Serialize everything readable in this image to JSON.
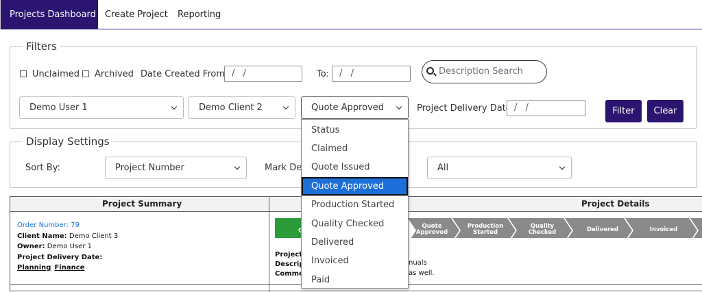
{
  "nav": {
    "tabs": [
      {
        "label": "Projects Dashboard",
        "active": true
      },
      {
        "label": "Create Project",
        "active": false
      },
      {
        "label": "Reporting",
        "active": false
      }
    ]
  },
  "filters": {
    "legend": "Filters",
    "unclaimed_label": "Unclaimed",
    "archived_label": "Archived",
    "date_created_from_label": "Date Created From:",
    "date_from_value": "/ /",
    "to_label": "To:",
    "date_to_value": "/ /",
    "search_placeholder": "Description Search",
    "user_select": "Demo User 1",
    "client_select": "Demo Client 2",
    "status_select": "Quote Approved",
    "delivery_date_label": "Project Delivery Date",
    "delivery_date_value": "/ /",
    "filter_button": "Filter",
    "clear_button": "Clear"
  },
  "status_dropdown": {
    "options": [
      "Status",
      "Claimed",
      "Quote Issued",
      "Quote Approved",
      "Production Started",
      "Quality Checked",
      "Delivered",
      "Invoiced",
      "Paid"
    ],
    "selected": "Quote Approved"
  },
  "display": {
    "legend": "Display Settings",
    "sort_by_label": "Sort By:",
    "sort_select": "Project Number",
    "mark_label": "Mark Del",
    "all_select": "All"
  },
  "table": {
    "summary_header": "Project Summary",
    "details_header": "Project Details",
    "order_number": "Order Number: 79",
    "client_name_label": "Client Name:",
    "client_name_value": "Demo Client 3",
    "owner_label": "Owner:",
    "owner_value": "Demo User 1",
    "delivery_label": "Project Delivery Date:",
    "planning_link": "Planning",
    "finance_link": "Finance",
    "detail_labels": [
      "Project",
      "Descrip",
      "Comme"
    ],
    "detail_values": [
      "nuals",
      "as well."
    ],
    "first_stage_letter": "C",
    "stages": [
      {
        "line1": "Quote",
        "line2": "Approved"
      },
      {
        "line1": "Production",
        "line2": "Started"
      },
      {
        "line1": "Quality",
        "line2": "Checked"
      },
      {
        "line1": "Delivered",
        "line2": ""
      },
      {
        "line1": "Invoiced",
        "line2": ""
      }
    ]
  },
  "colors": {
    "brand": "#2b1570",
    "stage_done": "#2e9b3a",
    "stage_pending": "#8a8a8a",
    "selected_option": "#1e6fd9"
  }
}
